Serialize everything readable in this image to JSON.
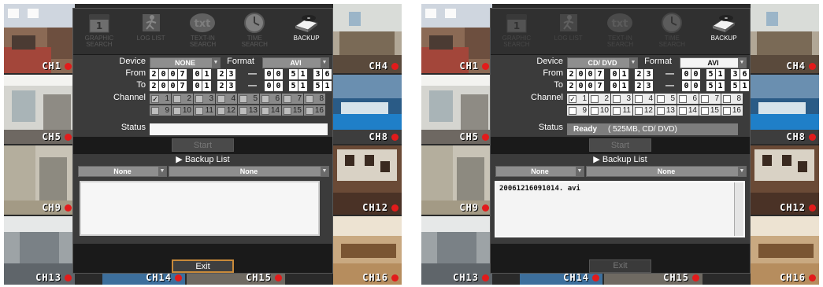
{
  "toolbar": {
    "items": [
      {
        "label": "GRAPHIC\nSEARCH",
        "icon": "calendar-icon"
      },
      {
        "label": "LOG LIST",
        "icon": "running-man-icon"
      },
      {
        "label": "TEXT-IN\nSEARCH",
        "icon": "txt-icon"
      },
      {
        "label": "TIME\nSEARCH",
        "icon": "clock-icon"
      },
      {
        "label": "BACKUP",
        "icon": "disc-drive-icon"
      }
    ]
  },
  "labels": {
    "device": "Device",
    "format": "Format",
    "from": "From",
    "to": "To",
    "channel": "Channel",
    "status": "Status",
    "start": "Start",
    "backup_list": "Backup List",
    "exit": "Exit",
    "dash": "—"
  },
  "cameras": {
    "ch1": "CH1",
    "ch4": "CH4",
    "ch5": "CH5",
    "ch8": "CH8",
    "ch9": "CH9",
    "ch12": "CH12",
    "ch13": "CH13",
    "ch14": "CH14",
    "ch15": "CH15",
    "ch16": "CH16"
  },
  "channels": [
    "1",
    "2",
    "3",
    "4",
    "5",
    "6",
    "7",
    "8",
    "9",
    "10",
    "11",
    "12",
    "13",
    "14",
    "15",
    "16"
  ],
  "left": {
    "device": "NONE",
    "format": "AVI",
    "from_date": [
      "2",
      "0",
      "0",
      "7",
      "0",
      "1",
      "2",
      "3"
    ],
    "from_time": [
      "0",
      "0",
      "5",
      "1",
      "3",
      "6"
    ],
    "to_date": [
      "2",
      "0",
      "0",
      "7",
      "0",
      "1",
      "2",
      "3"
    ],
    "to_time": [
      "0",
      "0",
      "5",
      "1",
      "5",
      "1"
    ],
    "checked": [
      1
    ],
    "status": "",
    "list_col1": "None",
    "list_col2": "None",
    "files": []
  },
  "right": {
    "device": "CD/ DVD",
    "format": "AVI",
    "from_date": [
      "2",
      "0",
      "0",
      "7",
      "0",
      "1",
      "2",
      "3"
    ],
    "from_time": [
      "0",
      "0",
      "5",
      "1",
      "3",
      "6"
    ],
    "to_date": [
      "2",
      "0",
      "0",
      "7",
      "0",
      "1",
      "2",
      "3"
    ],
    "to_time": [
      "0",
      "0",
      "5",
      "1",
      "5",
      "1"
    ],
    "checked": [
      1
    ],
    "status_ready": "Ready",
    "status_info": "( 525MB,  CD/ DVD)",
    "list_col1": "None",
    "list_col2": "None",
    "files": [
      "20061216091014. avi"
    ]
  },
  "colors": {
    "accent_exit_border": "#c98a3a",
    "record_dot": "#e21b1b"
  }
}
